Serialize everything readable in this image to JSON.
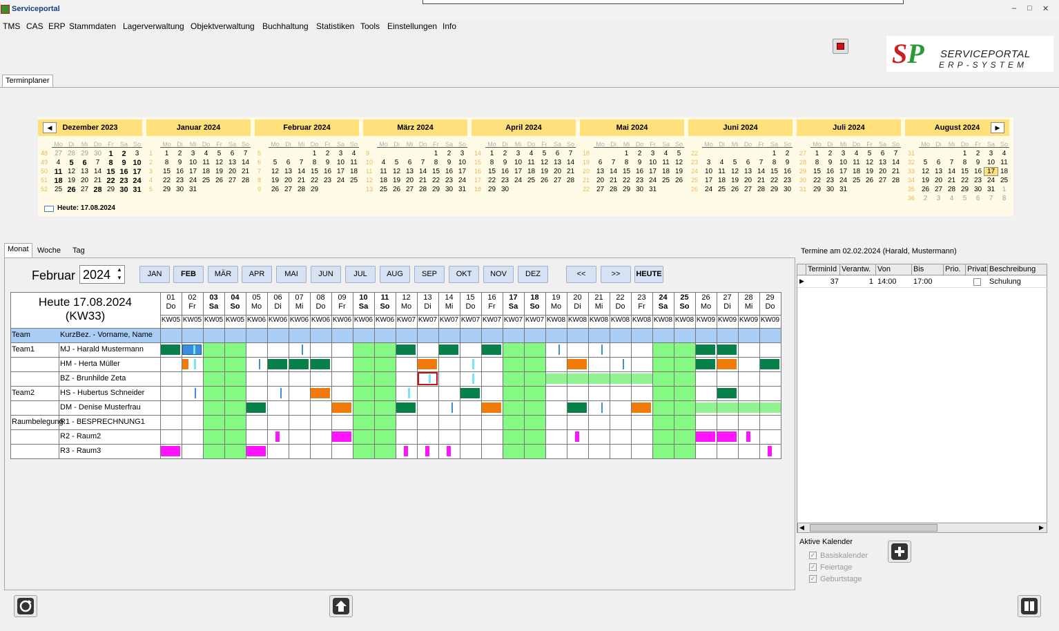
{
  "app": {
    "title": "Serviceportal",
    "min": "–",
    "max": "□",
    "close": "✕"
  },
  "menu": [
    "TMS",
    "CAS",
    "ERP",
    "Stammdaten",
    "Lagerverwaltung",
    "Objektverwaltung",
    "Buchhaltung",
    "Statistiken",
    "Tools",
    "Einstellungen",
    "Info"
  ],
  "logo": {
    "line1": "SERVICEPORTAL",
    "line2": "ERP-SYSTEM",
    "mark": "SP"
  },
  "main_tab": "Terminplaner",
  "mini_calendar": {
    "weekdays": [
      "Mo",
      "Di",
      "Mi",
      "Do",
      "Fr",
      "Sa",
      "So"
    ],
    "today_label": "Heute: 17.08.2024",
    "months": [
      {
        "name": "Dezember 2023",
        "rows": [
          [
            "48",
            "27o",
            "28o",
            "29o",
            "30o",
            "1b",
            "2b",
            "3"
          ],
          [
            "49",
            "4",
            "5b",
            "6b",
            "7",
            "8b",
            "9b",
            "10b"
          ],
          [
            "50",
            "11b",
            "12",
            "13",
            "14",
            "15b",
            "16b",
            "17b"
          ],
          [
            "51",
            "18b",
            "19",
            "20",
            "21",
            "22b",
            "23b",
            "24b"
          ],
          [
            "52",
            "25",
            "26b",
            "27",
            "28b",
            "29",
            "30b",
            "31b"
          ]
        ]
      },
      {
        "name": "Januar 2024",
        "rows": [
          [
            "1",
            "1",
            "2",
            "3",
            "4",
            "5",
            "6",
            "7"
          ],
          [
            "2",
            "8",
            "9",
            "10",
            "11",
            "12",
            "13",
            "14"
          ],
          [
            "3",
            "15",
            "16",
            "17",
            "18",
            "19",
            "20",
            "21"
          ],
          [
            "4",
            "22",
            "23",
            "24",
            "25",
            "26",
            "27",
            "28"
          ],
          [
            "5",
            "29",
            "30",
            "31",
            "",
            "",
            "",
            ""
          ]
        ]
      },
      {
        "name": "Februar 2024",
        "rows": [
          [
            "5",
            "",
            "",
            "",
            "1",
            "2",
            "3",
            "4"
          ],
          [
            "6",
            "5",
            "6",
            "7",
            "8",
            "9",
            "10",
            "11"
          ],
          [
            "7",
            "12",
            "13",
            "14",
            "15",
            "16",
            "17",
            "18"
          ],
          [
            "8",
            "19",
            "20",
            "21",
            "22",
            "23",
            "24",
            "25"
          ],
          [
            "9",
            "26",
            "27",
            "28",
            "29",
            "",
            "",
            ""
          ]
        ]
      },
      {
        "name": "März 2024",
        "rows": [
          [
            "9",
            "",
            "",
            "",
            "",
            "1",
            "2",
            "3"
          ],
          [
            "10",
            "4",
            "5",
            "6",
            "7",
            "8",
            "9",
            "10"
          ],
          [
            "11",
            "11",
            "12",
            "13",
            "14",
            "15",
            "16",
            "17"
          ],
          [
            "12",
            "18",
            "19",
            "20",
            "21",
            "22",
            "23",
            "24"
          ],
          [
            "13",
            "25",
            "26",
            "27",
            "28",
            "29",
            "30",
            "31"
          ]
        ]
      },
      {
        "name": "April 2024",
        "rows": [
          [
            "14",
            "1",
            "2",
            "3",
            "4",
            "5",
            "6",
            "7"
          ],
          [
            "15",
            "8",
            "9",
            "10",
            "11",
            "12",
            "13",
            "14"
          ],
          [
            "16",
            "15",
            "16",
            "17",
            "18",
            "19",
            "20",
            "21"
          ],
          [
            "17",
            "22",
            "23",
            "24",
            "25",
            "26",
            "27",
            "28"
          ],
          [
            "18",
            "29",
            "30",
            "",
            "",
            "",
            "",
            ""
          ]
        ]
      },
      {
        "name": "Mai 2024",
        "rows": [
          [
            "18",
            "",
            "",
            "1",
            "2",
            "3",
            "4",
            "5"
          ],
          [
            "19",
            "6",
            "7",
            "8",
            "9",
            "10",
            "11",
            "12"
          ],
          [
            "20",
            "13",
            "14",
            "15",
            "16",
            "17",
            "18",
            "19"
          ],
          [
            "21",
            "20",
            "21",
            "22",
            "23",
            "24",
            "25",
            "26"
          ],
          [
            "22",
            "27",
            "28",
            "29",
            "30",
            "31",
            "",
            ""
          ]
        ]
      },
      {
        "name": "Juni 2024",
        "rows": [
          [
            "22",
            "",
            "",
            "",
            "",
            "",
            "1",
            "2"
          ],
          [
            "23",
            "3",
            "4",
            "5",
            "6",
            "7",
            "8",
            "9"
          ],
          [
            "24",
            "10",
            "11",
            "12",
            "13",
            "14",
            "15",
            "16"
          ],
          [
            "25",
            "17",
            "18",
            "19",
            "20",
            "21",
            "22",
            "23"
          ],
          [
            "26",
            "24",
            "25",
            "26",
            "27",
            "28",
            "29",
            "30"
          ]
        ]
      },
      {
        "name": "Juli 2024",
        "rows": [
          [
            "27",
            "1",
            "2",
            "3",
            "4",
            "5",
            "6",
            "7"
          ],
          [
            "28",
            "8",
            "9",
            "10",
            "11",
            "12",
            "13",
            "14"
          ],
          [
            "29",
            "15",
            "16",
            "17",
            "18",
            "19",
            "20",
            "21"
          ],
          [
            "30",
            "22",
            "23",
            "24",
            "25",
            "26",
            "27",
            "28"
          ],
          [
            "31",
            "29",
            "30",
            "31",
            "",
            "",
            "",
            ""
          ]
        ]
      },
      {
        "name": "August 2024",
        "rows": [
          [
            "31",
            "",
            "",
            "",
            "1",
            "2",
            "3",
            "4"
          ],
          [
            "32",
            "5",
            "6",
            "7",
            "8",
            "9",
            "10",
            "11"
          ],
          [
            "33",
            "12",
            "13",
            "14",
            "15",
            "16",
            "17t",
            "18"
          ],
          [
            "34",
            "19",
            "20",
            "21",
            "22",
            "23",
            "24",
            "25"
          ],
          [
            "35",
            "26",
            "27",
            "28",
            "29",
            "30",
            "31",
            "1o"
          ],
          [
            "36",
            "2o",
            "3o",
            "4o",
            "5o",
            "6o",
            "7o",
            "8o"
          ]
        ]
      }
    ]
  },
  "view_tabs": [
    "Monat",
    "Woche",
    "Tag"
  ],
  "planner": {
    "month_label": "Februar",
    "year": "2024",
    "month_buttons": [
      "JAN",
      "FEB",
      "MÄR",
      "APR",
      "MAI",
      "JUN",
      "JUL",
      "AUG",
      "SEP",
      "OKT",
      "NOV",
      "DEZ"
    ],
    "prev": "<<",
    "next": ">>",
    "today_btn": "HEUTE",
    "heute_line1": "Heute 17.08.2024",
    "heute_line2": "(KW33)",
    "col_team": "Team",
    "col_name": "KurzBez. - Vorname, Name",
    "days": [
      [
        "01",
        "Do",
        "KW05"
      ],
      [
        "02",
        "Fr",
        "KW05"
      ],
      [
        "03",
        "Sa",
        "KW05"
      ],
      [
        "04",
        "So",
        "KW05"
      ],
      [
        "05",
        "Mo",
        "KW06"
      ],
      [
        "06",
        "Di",
        "KW06"
      ],
      [
        "07",
        "Mi",
        "KW06"
      ],
      [
        "08",
        "Do",
        "KW06"
      ],
      [
        "09",
        "Fr",
        "KW06"
      ],
      [
        "10",
        "Sa",
        "KW06"
      ],
      [
        "11",
        "So",
        "KW06"
      ],
      [
        "12",
        "Mo",
        "KW07"
      ],
      [
        "13",
        "Di",
        "KW07"
      ],
      [
        "14",
        "Mi",
        "KW07"
      ],
      [
        "15",
        "Do",
        "KW07"
      ],
      [
        "16",
        "Fr",
        "KW07"
      ],
      [
        "17",
        "Sa",
        "KW07"
      ],
      [
        "18",
        "So",
        "KW07"
      ],
      [
        "19",
        "Mo",
        "KW08"
      ],
      [
        "20",
        "Di",
        "KW08"
      ],
      [
        "21",
        "Mi",
        "KW08"
      ],
      [
        "22",
        "Do",
        "KW08"
      ],
      [
        "23",
        "Fr",
        "KW08"
      ],
      [
        "24",
        "Sa",
        "KW08"
      ],
      [
        "25",
        "So",
        "KW08"
      ],
      [
        "26",
        "Mo",
        "KW09"
      ],
      [
        "27",
        "Di",
        "KW09"
      ],
      [
        "28",
        "Mi",
        "KW09"
      ],
      [
        "29",
        "Do",
        "KW09"
      ]
    ],
    "rows": [
      {
        "team": "Team1",
        "name": "MJ - Harald Mustermann"
      },
      {
        "team": "",
        "name": "HM - Herta Müller"
      },
      {
        "team": "",
        "name": "BZ - Brunhilde Zeta"
      },
      {
        "team": "Team2",
        "name": "HS - Hubertus Schneider"
      },
      {
        "team": "",
        "name": "DM - Denise Musterfrau"
      },
      {
        "team": "Raumbelegung",
        "name": "R1 -  BESPRECHNUNG1"
      },
      {
        "team": "",
        "name": "R2 -  Raum2"
      },
      {
        "team": "",
        "name": "R3 -  Raum3"
      }
    ]
  },
  "details": {
    "title": "Termine am 02.02.2024 (Harald, Mustermann)",
    "columns": [
      "TerminId",
      "Verantw.",
      "Von",
      "Bis",
      "Prio.",
      "Privat",
      "Beschreibung"
    ],
    "rows": [
      {
        "id": "37",
        "verantw": "1",
        "von": "14:00",
        "bis": "17:00",
        "prio": "",
        "beschreibung": "Schulung"
      }
    ],
    "active_title": "Aktive Kalender",
    "calendars": [
      "Basiskalender",
      "Feiertage",
      "Geburtstage"
    ],
    "check": "✓"
  },
  "colors": {
    "weekend": "#84fa84",
    "dark_green": "#07804a",
    "orange": "#f07a0a",
    "magenta": "#ff14ff",
    "light_green": "#90f290",
    "blue": "#3a8ee0"
  }
}
